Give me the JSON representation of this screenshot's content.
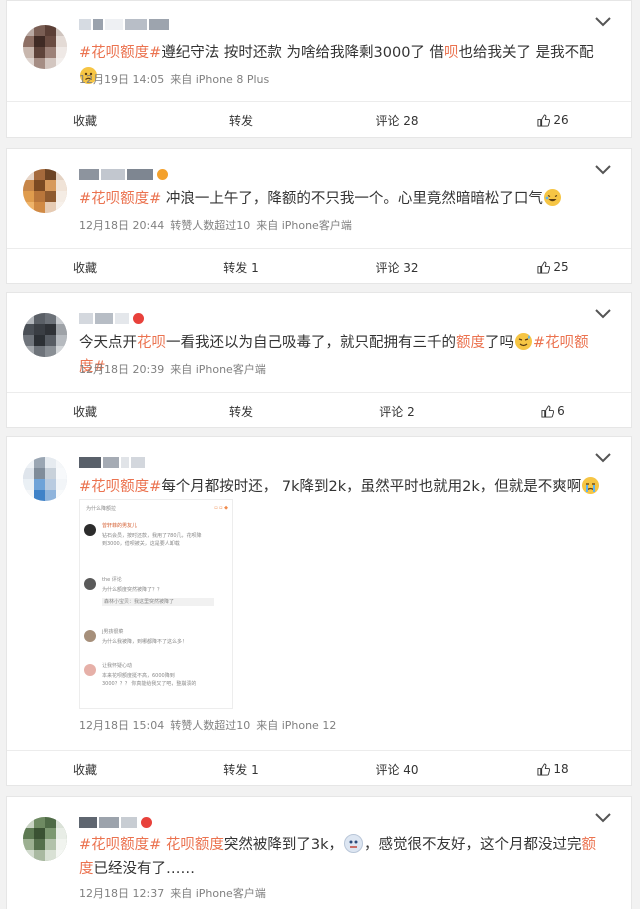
{
  "posts": [
    {
      "tag": "#花呗额度#",
      "text": "遵纪守法 按时还款 为啥给我降剩3000了 借呗也给我关了 是我不配",
      "text_parts": [
        "遵纪守法 按时还款 为啥给我降剩3000了 借",
        "呗",
        "也给我关了 是我不配"
      ],
      "date": "12月19日 14:05",
      "source": "来自 iPhone 8 Plus",
      "actions": {
        "fav": "收藏",
        "repost": "转发",
        "comment": "评论 28",
        "like": "26"
      }
    },
    {
      "tag": "#花呗额度#",
      "text": "冲浪一上午了，降额的不只我一个。心里竟然暗暗松了口气",
      "date": "12月18日 20:44",
      "reposts_note": "转赞人数超过10",
      "source": "来自 iPhone客户端",
      "actions": {
        "fav": "收藏",
        "repost": "转发 1",
        "comment": "评论 32",
        "like": "25"
      }
    },
    {
      "text_a": "今天点开",
      "text_hl1": "花呗",
      "text_b": "一看我还以为自己吸毒了，就只配拥有三千的",
      "text_hl2": "额度",
      "text_c": "了吗",
      "tag": "#花呗额度#",
      "date": "12月18日 20:39",
      "source": "来自 iPhone客户端",
      "actions": {
        "fav": "收藏",
        "repost": "转发",
        "comment": "评论 2",
        "like": "6"
      }
    },
    {
      "tag": "#花呗额度#",
      "text": "每个月都按时还， 7k降到2k，虽然平时也就用2k，但就是不爽啊",
      "embed_lines": [
        "为什么降额拉",
        "曾轩菲的男友儿",
        "钻石会员，按时还款，我用了780几，花呗降",
        "到3000，借呗被关，这是要人卸载",
        "the 评论",
        "为什么额度突然被降了？？",
        "森林小宝贝：我这里突然被降了",
        "j男孩很菜",
        "为什么我被降，到哪都降不了这么多！",
        "让我怀疑心动",
        "本来花呗额度挺不高，6000降到",
        "3000？？？ 你真能给我又了吧，整崩溃的"
      ],
      "date": "12月18日 15:04",
      "reposts_note": "转赞人数超过10",
      "source": "来自 iPhone 12",
      "actions": {
        "fav": "收藏",
        "repost": "转发 1",
        "comment": "评论 40",
        "like": "18"
      }
    },
    {
      "tag": "#花呗额度#",
      "tag2": "花呗额度",
      "text_a": "突然被降到了3k，",
      "text_b": "，感觉很不友好，这个月都没过完",
      "text_hl": "额度",
      "text_c": "已经没有了……",
      "date": "12月18日 12:37",
      "source": "来自 iPhone客户端"
    }
  ],
  "colors": {
    "accent": "#eb7350",
    "meta": "#808080",
    "bg": "#f2f2f2"
  },
  "icons": [
    "chevron-down-icon",
    "thumbs-up-icon",
    "avatar"
  ]
}
